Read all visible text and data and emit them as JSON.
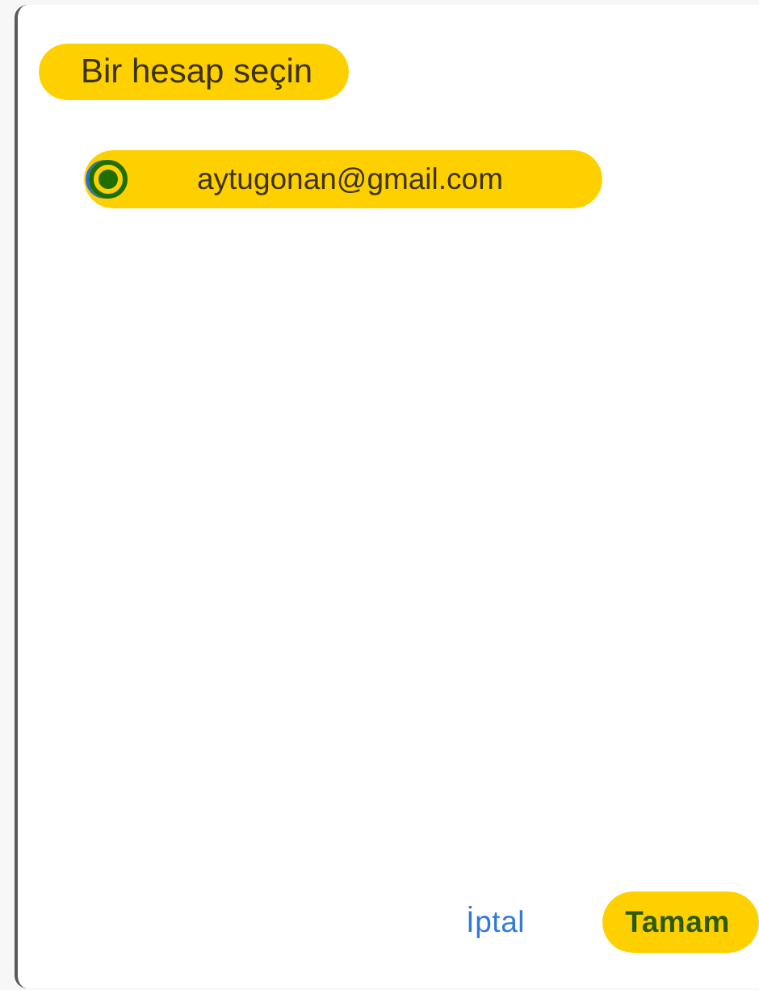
{
  "dialog": {
    "title": {
      "text": "Bir hesap seçin",
      "highlighted": true
    },
    "accounts": [
      {
        "email": "aytugonan@gmail.com",
        "selected": true,
        "highlighted": true
      }
    ],
    "buttons": [
      {
        "label": "İptal",
        "highlighted": false
      },
      {
        "label": "Tamam",
        "highlighted": true
      }
    ]
  }
}
